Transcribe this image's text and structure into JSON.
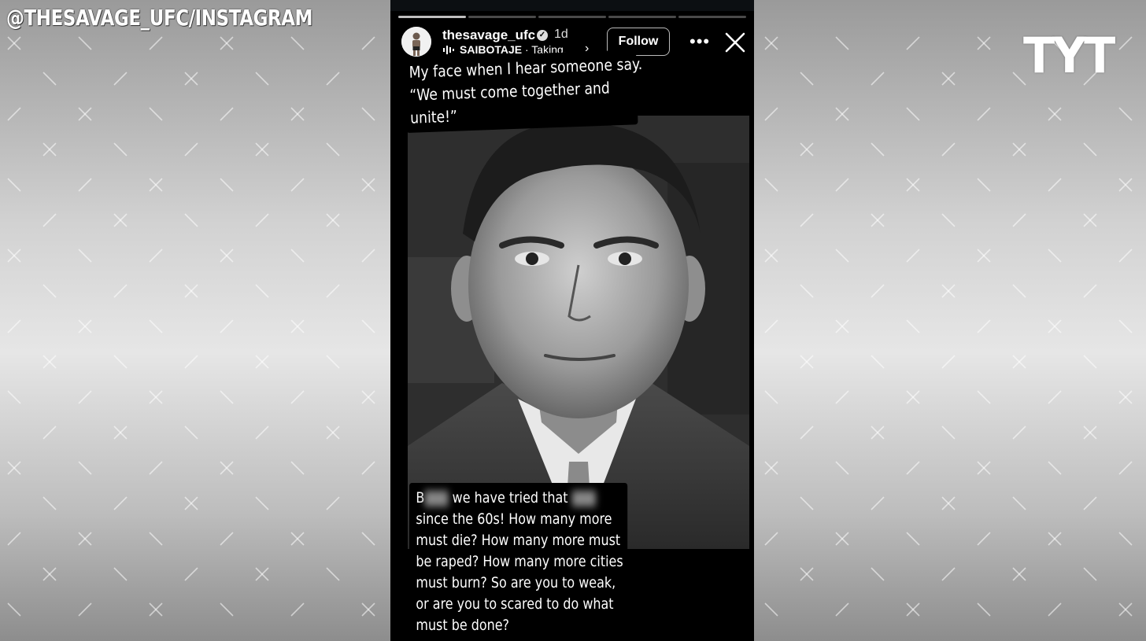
{
  "watermark": "@THESAVAGE_UFC/INSTAGRAM",
  "logo": "TYT",
  "story": {
    "progress": {
      "segments": 5,
      "active_index": 0
    },
    "username": "thesavage_ufc",
    "verified_icon": "verified-badge-icon",
    "time": "1d",
    "music_artist": "SAIBOTAJE",
    "music_sep": " · ",
    "music_title": "Taking...",
    "follow_label": "Follow",
    "more_icon": "more-horizontal-icon",
    "close_icon": "close-icon"
  },
  "caption_top": {
    "lines": [
      "My face when I hear someone say.",
      "“We must come together and",
      "unite!”"
    ]
  },
  "caption_bottom": {
    "line1_a": "B",
    "line1_b": " we have tried that ",
    "lines": [
      "since the 60s! How many more",
      "must die? How many more must",
      "be raped? How many more cities",
      "must burn? So are you to weak,",
      "or are you to scared to do what",
      "must be done?"
    ]
  },
  "colors": {
    "story_bg": "#000000",
    "text": "#ffffff",
    "follow_border": "#bbbbbb"
  }
}
